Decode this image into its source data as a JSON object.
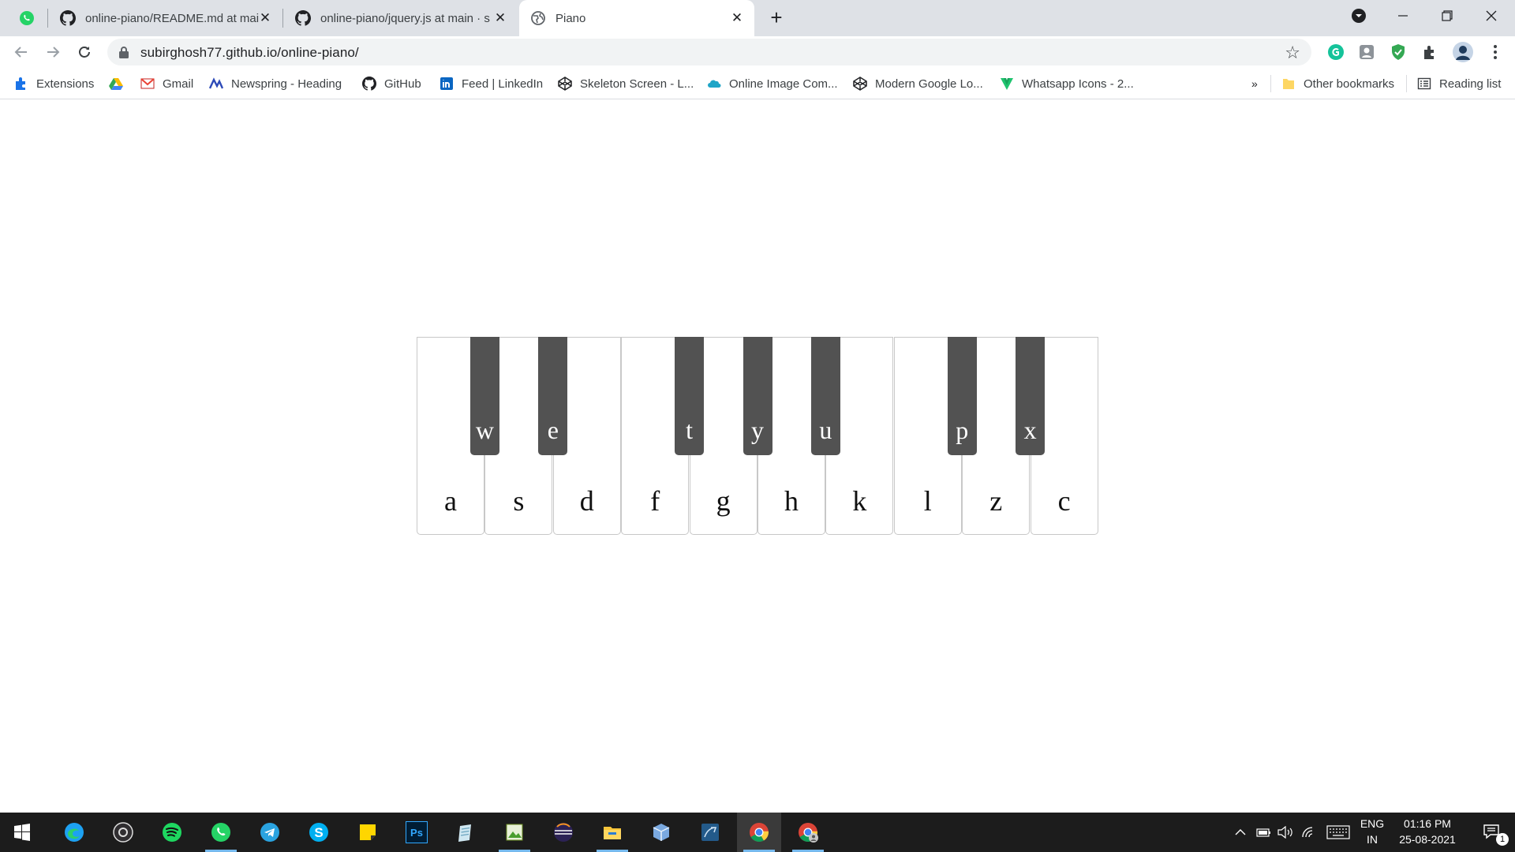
{
  "tabs": [
    {
      "title": "",
      "icon": "whatsapp-icon"
    },
    {
      "title": "online-piano/README.md at mai",
      "icon": "github-icon"
    },
    {
      "title": "online-piano/jquery.js at main · s",
      "icon": "github-icon"
    },
    {
      "title": "Piano",
      "icon": "globe-icon",
      "active": true
    }
  ],
  "toolbar": {
    "url": "subirghosh77.github.io/online-piano/"
  },
  "bookmarks": [
    {
      "label": "Extensions",
      "icon": "puzzle-icon"
    },
    {
      "label": "",
      "icon": "google-drive-icon"
    },
    {
      "label": "Gmail",
      "icon": "gmail-icon"
    },
    {
      "label": "Newspring - Heading",
      "icon": "newspring-icon"
    },
    {
      "label": "GitHub",
      "icon": "github-icon"
    },
    {
      "label": "Feed | LinkedIn",
      "icon": "linkedin-icon"
    },
    {
      "label": "Skeleton Screen - L...",
      "icon": "codepen-icon"
    },
    {
      "label": "Online Image Com...",
      "icon": "cloud-icon"
    },
    {
      "label": "Modern Google Lo...",
      "icon": "codepen-icon"
    },
    {
      "label": "Whatsapp Icons - 2...",
      "icon": "vuetify-icon"
    }
  ],
  "bookmarks_overflow": "»",
  "bookmarks_right": {
    "other": "Other bookmarks",
    "reading": "Reading list"
  },
  "piano": {
    "white_keys": [
      "a",
      "s",
      "d",
      "f",
      "g",
      "h",
      "k",
      "l",
      "z",
      "c"
    ],
    "black_keys": [
      "w",
      "e",
      "t",
      "y",
      "u",
      "p",
      "x"
    ]
  },
  "taskbar": {
    "apps": [
      "start-icon",
      "edge-icon",
      "obs-icon",
      "spotify-icon",
      "whatsapp-icon",
      "telegram-icon",
      "skype-icon",
      "sticky-notes-icon",
      "photoshop-icon",
      "notepad-icon",
      "image-viewer-icon",
      "eclipse-icon",
      "file-explorer-icon",
      "3d-box-icon",
      "sql-icon",
      "chrome-icon",
      "chrome-profile-icon"
    ],
    "photoshop_label": "Ps",
    "lang_line1": "ENG",
    "lang_line2": "IN",
    "time": "01:16 PM",
    "date": "25-08-2021",
    "notification_count": "1"
  },
  "colors": {
    "tabstrip": "#dee1e6",
    "black_key": "#525252",
    "taskbar": "#1c1c1c",
    "accent": "#76b9ed"
  }
}
